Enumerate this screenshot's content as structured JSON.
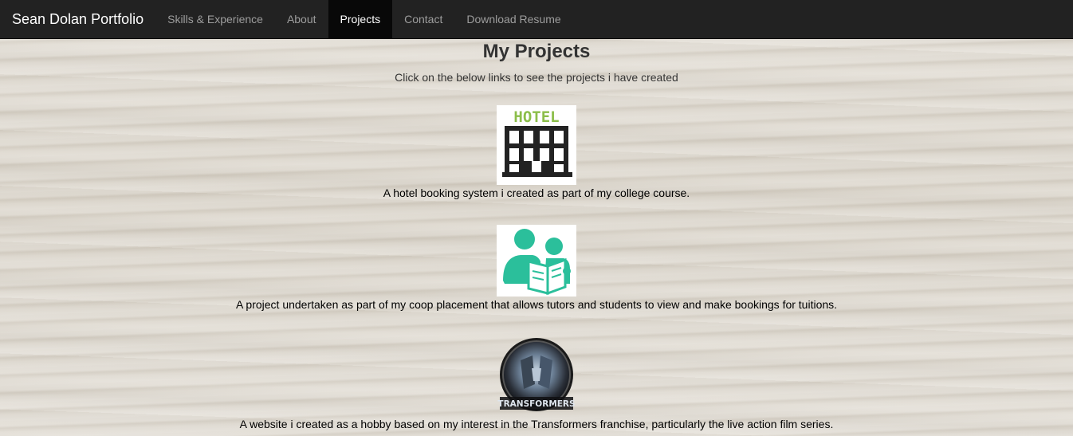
{
  "navbar": {
    "brand": "Sean Dolan Portfolio",
    "links": [
      {
        "label": "Skills & Experience",
        "active": false
      },
      {
        "label": "About",
        "active": false
      },
      {
        "label": "Projects",
        "active": true
      },
      {
        "label": "Contact",
        "active": false
      },
      {
        "label": "Download Resume",
        "active": false
      }
    ]
  },
  "main": {
    "title": "My Projects",
    "subtitle": "Click on the below links to see the projects i have created",
    "projects": [
      {
        "icon": "hotel-building-icon",
        "icon_text": "HOTEL",
        "description": "A hotel booking system i created as part of my college course."
      },
      {
        "icon": "tutor-reading-icon",
        "description": "A project undertaken as part of my coop placement that allows tutors and students to view and make bookings for tuitions."
      },
      {
        "icon": "transformers-logo-icon",
        "icon_text": "TRANSFORMERS",
        "description": "A website i created as a hobby based on my interest in the Transformers franchise, particularly the live action film series."
      }
    ]
  },
  "colors": {
    "navbar_bg": "#222222",
    "active_nav_bg": "#080808",
    "hotel_text": "#8cbe4a",
    "tutor_teal": "#2bbf9b"
  }
}
